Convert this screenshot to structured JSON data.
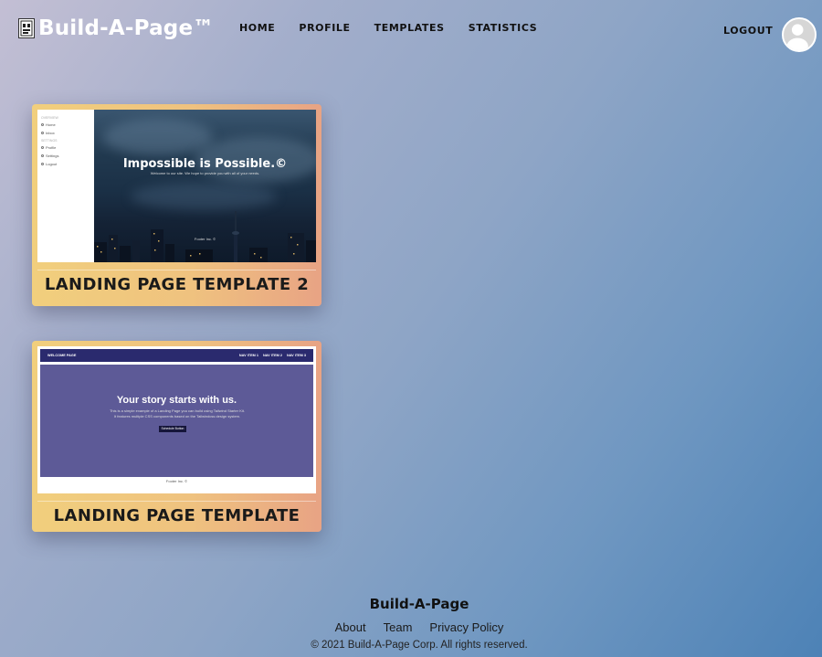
{
  "header": {
    "logo_text": "Build-A-Page™",
    "nav": [
      "HOME",
      "PROFILE",
      "TEMPLATES",
      "STATISTICS"
    ],
    "logout_label": "LOGOUT"
  },
  "templates": [
    {
      "title": "LANDING PAGE TEMPLATE 2",
      "preview": {
        "heading": "Impossible is Possible.©",
        "subtext": "Welcome to our site. We hope to provide you with all of your needs.",
        "footer": "Footer Inc. ©"
      }
    },
    {
      "title": "LANDING PAGE TEMPLATE",
      "preview": {
        "nav_brand": "WELCOME PAGE",
        "nav_links": [
          "NAV ITEM 1",
          "NAV ITEM 2",
          "NAV ITEM 3"
        ],
        "heading": "Your story starts with us.",
        "paragraph": "This is a simple example of a Landing Page you can build using Tailwind Starter Kit. It features multiple CSS components based on the Tailwindcss design system.",
        "button": "Schedule Button",
        "footer": "Footer Inc. ©"
      }
    }
  ],
  "footer": {
    "brand": "Build-A-Page",
    "links": [
      "About",
      "Team",
      "Privacy Policy"
    ],
    "copyright": "© 2021 Build-A-Page Corp. All rights reserved."
  }
}
